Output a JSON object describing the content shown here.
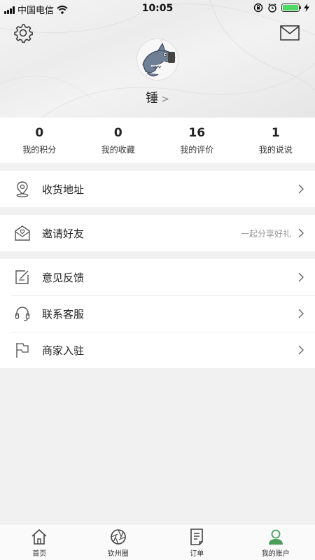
{
  "status_bar": {
    "carrier": "中国电信",
    "time": "10:05"
  },
  "profile": {
    "username": "锤",
    "chevron": ">"
  },
  "stats": [
    {
      "value": "0",
      "label": "我的积分"
    },
    {
      "value": "0",
      "label": "我的收藏"
    },
    {
      "value": "16",
      "label": "我的评价"
    },
    {
      "value": "1",
      "label": "我的说说"
    }
  ],
  "menu": {
    "address": {
      "label": "收货地址",
      "icon": "location-pin-icon"
    },
    "invite": {
      "label": "邀请好友",
      "hint": "一起分享好礼",
      "icon": "gift-envelope-icon"
    },
    "feedback": {
      "label": "意见反馈",
      "icon": "edit-note-icon"
    },
    "service": {
      "label": "联系客服",
      "icon": "headset-icon"
    },
    "merchant": {
      "label": "商家入驻",
      "icon": "flag-icon"
    }
  },
  "tabbar": [
    {
      "label": "首页",
      "icon": "home-icon"
    },
    {
      "label": "钦州圈",
      "icon": "aperture-icon"
    },
    {
      "label": "订单",
      "icon": "order-document-icon"
    },
    {
      "label": "我的账户",
      "icon": "user-icon",
      "active": true
    }
  ],
  "colors": {
    "accent_green": "#4a9e5c",
    "battery_green": "#4cd964"
  }
}
